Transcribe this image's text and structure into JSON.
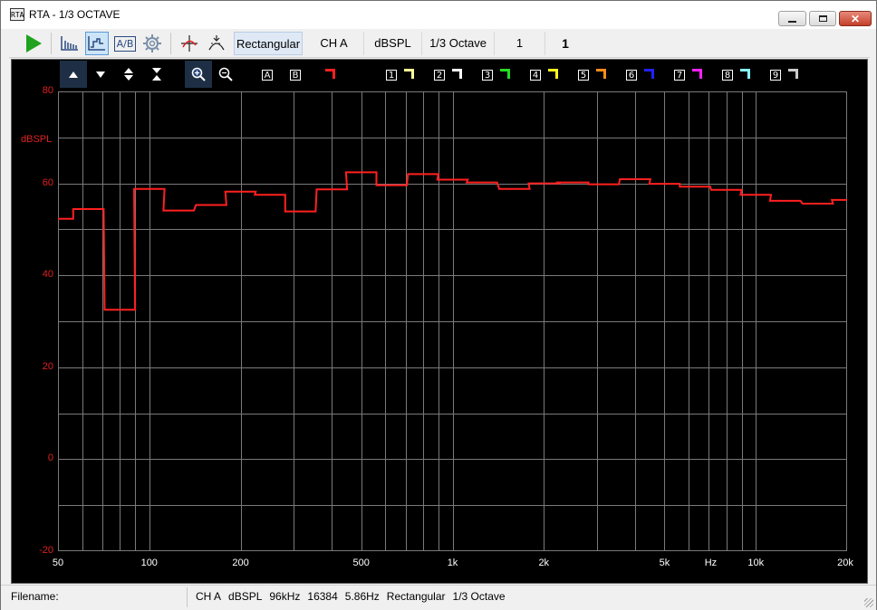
{
  "window": {
    "title": "RTA - 1/3 OCTAVE",
    "app_icon_label": "RTA"
  },
  "toolbar": {
    "window_type": "Rectangular",
    "channel": "CH A",
    "units": "dBSPL",
    "octave": "1/3 Octave",
    "averages": "1",
    "value_bold": "1"
  },
  "graph_toolbar": {
    "trace_a": "A",
    "trace_b": "B",
    "traces": [
      {
        "label": "1",
        "color": "#ffff99"
      },
      {
        "label": "2",
        "color": "#ffffff"
      },
      {
        "label": "3",
        "color": "#22dd22"
      },
      {
        "label": "4",
        "color": "#ffff22"
      },
      {
        "label": "5",
        "color": "#ff8c1a"
      },
      {
        "label": "6",
        "color": "#2222ff"
      },
      {
        "label": "7",
        "color": "#ff22ff"
      },
      {
        "label": "8",
        "color": "#88ffff"
      },
      {
        "label": "9",
        "color": "#cccccc"
      }
    ],
    "trace_a_color": "#ff2020"
  },
  "chart_data": {
    "type": "line",
    "ylabel": "dBSPL",
    "xlabel": "Hz",
    "ylim": [
      -20,
      80
    ],
    "xlim": [
      50,
      20000
    ],
    "x_scale": "log",
    "grid": true,
    "y_ticks": [
      "80",
      "60",
      "40",
      "20",
      "0",
      "-20"
    ],
    "x_tick_labels": [
      {
        "f": 50,
        "label": "50"
      },
      {
        "f": 100,
        "label": "100"
      },
      {
        "f": 200,
        "label": "200"
      },
      {
        "f": 500,
        "label": "500"
      },
      {
        "f": 1000,
        "label": "1k"
      },
      {
        "f": 2000,
        "label": "2k"
      },
      {
        "f": 5000,
        "label": "5k"
      },
      {
        "f": 7100,
        "label": "Hz"
      },
      {
        "f": 10000,
        "label": "10k"
      },
      {
        "f": 20000,
        "label": "20k"
      }
    ],
    "series": [
      {
        "color": "#ff2020",
        "bands": [
          {
            "f": 50,
            "db": 52.3
          },
          {
            "f": 63,
            "db": 54.4
          },
          {
            "f": 80,
            "db": 32.5
          },
          {
            "f": 100,
            "db": 58.8
          },
          {
            "f": 125,
            "db": 54.1
          },
          {
            "f": 160,
            "db": 55.3
          },
          {
            "f": 200,
            "db": 58.2
          },
          {
            "f": 250,
            "db": 57.5
          },
          {
            "f": 315,
            "db": 53.9
          },
          {
            "f": 400,
            "db": 58.7
          },
          {
            "f": 500,
            "db": 62.4
          },
          {
            "f": 630,
            "db": 59.6
          },
          {
            "f": 800,
            "db": 62.0
          },
          {
            "f": 1000,
            "db": 60.8
          },
          {
            "f": 1250,
            "db": 60.2
          },
          {
            "f": 1600,
            "db": 58.8
          },
          {
            "f": 2000,
            "db": 60.0
          },
          {
            "f": 2500,
            "db": 60.2
          },
          {
            "f": 3150,
            "db": 59.8
          },
          {
            "f": 4000,
            "db": 60.9
          },
          {
            "f": 5000,
            "db": 59.9
          },
          {
            "f": 6300,
            "db": 59.3
          },
          {
            "f": 8000,
            "db": 58.6
          },
          {
            "f": 10000,
            "db": 57.5
          },
          {
            "f": 12500,
            "db": 56.2
          },
          {
            "f": 16000,
            "db": 55.6
          },
          {
            "f": 20000,
            "db": 56.4
          }
        ]
      }
    ]
  },
  "status": {
    "filename_label": "Filename:",
    "channel": "CH A",
    "units": "dBSPL",
    "sample_rate": "96kHz",
    "fft_size": "16384",
    "resolution": "5.86Hz",
    "window": "Rectangular",
    "octave": "1/3 Octave"
  }
}
